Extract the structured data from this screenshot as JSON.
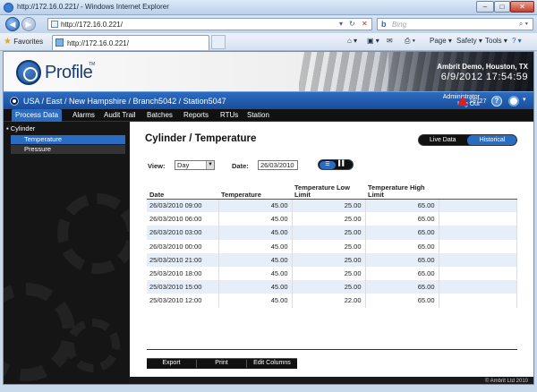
{
  "browser": {
    "window_title": "http://172.16.0.221/ - Windows Internet Explorer",
    "address": "http://172.16.0.221/",
    "search_placeholder": "Bing",
    "favorites_label": "Favorites",
    "tab_title": "http://172.16.0.221/",
    "commands": [
      "Page ▾",
      "Safety ▾",
      "Tools ▾"
    ]
  },
  "app": {
    "logo_text": "Profile",
    "logo_tm": "TM",
    "client": "Ambrit Demo, Houston, TX",
    "datetime": "6/9/2012   17:54:59",
    "breadcrumb": "USA / East / New Hampshire / Branch5042 / Station5047",
    "user_role": "Administrator",
    "logout": "Log Out",
    "alarm_count": "19727",
    "help": "?",
    "menu": [
      "Process Data",
      "Alarms",
      "Audit Trail",
      "Batches",
      "Reports",
      "RTUs",
      "Station"
    ],
    "footer": "© Ambrit Ltd 2010"
  },
  "sidebar": {
    "group": "Cylinder",
    "items": [
      "Temperature",
      "Pressure"
    ]
  },
  "main": {
    "title": "Cylinder / Temperature",
    "live_label": "Live Data",
    "historical_label": "Historical",
    "view_label": "View:",
    "view_value": "Day",
    "date_label": "Date:",
    "date_value": "26/03/2010",
    "columns": [
      "Date",
      "Temperature",
      "Temperature Low Limit",
      "Temperature High Limit",
      ""
    ],
    "rows": [
      [
        "26/03/2010 09:00",
        "45.00",
        "25.00",
        "65.00"
      ],
      [
        "26/03/2010 06:00",
        "45.00",
        "25.00",
        "65.00"
      ],
      [
        "26/03/2010 03:00",
        "45.00",
        "25.00",
        "65.00"
      ],
      [
        "26/03/2010 00:00",
        "45.00",
        "25.00",
        "65.00"
      ],
      [
        "25/03/2010 21:00",
        "45.00",
        "25.00",
        "65.00"
      ],
      [
        "25/03/2010 18:00",
        "45.00",
        "25.00",
        "65.00"
      ],
      [
        "25/03/2010 15:00",
        "45.00",
        "25.00",
        "65.00"
      ],
      [
        "25/03/2010 12:00",
        "45.00",
        "22.00",
        "65.00"
      ]
    ],
    "buttons": [
      "Export",
      "Print",
      "Edit Columns"
    ]
  },
  "colors": {
    "accent": "#2a6cc1",
    "alarm": "#e21d1d"
  }
}
